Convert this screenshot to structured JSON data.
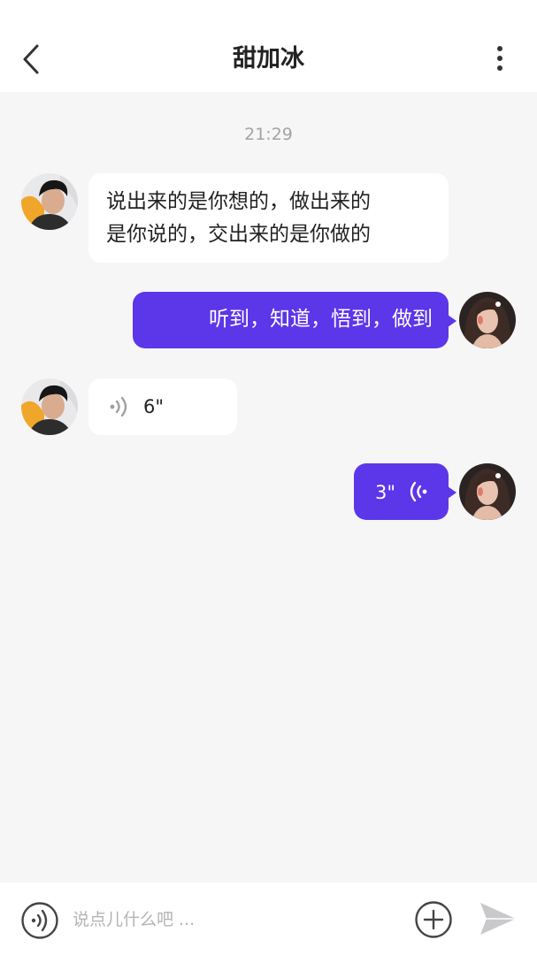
{
  "header": {
    "title": "甜加冰",
    "back_icon": "chevron-left-icon",
    "more_icon": "vertical-dots-icon"
  },
  "chat": {
    "timestamp": "21:29",
    "messages": [
      {
        "side": "in",
        "type": "text",
        "text": "说出来的是你想的，做出来的\n是你说的，交出来的是你做的"
      },
      {
        "side": "out",
        "type": "text",
        "text": "听到，知道，悟到，做到"
      },
      {
        "side": "in",
        "type": "voice",
        "duration": "6\""
      },
      {
        "side": "out",
        "type": "voice",
        "duration": "3\""
      }
    ]
  },
  "input_bar": {
    "placeholder": "说点儿什么吧 ...",
    "voice_icon": "voice-mode-icon",
    "add_icon": "plus-circle-icon",
    "send_icon": "send-icon"
  },
  "colors": {
    "accent": "#5c36e9",
    "background": "#f6f6f7",
    "incoming_bubble": "#ffffff",
    "timestamp": "#a3a3a3"
  }
}
